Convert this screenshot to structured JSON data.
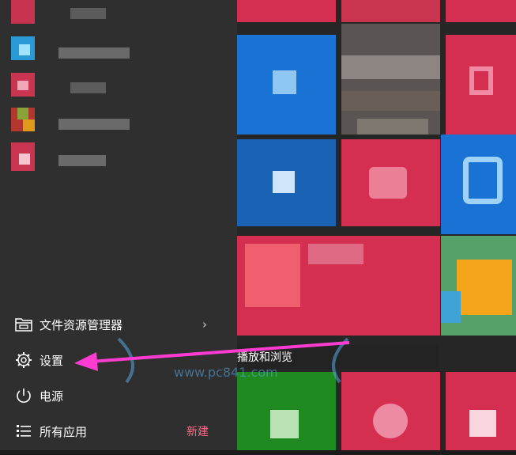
{
  "menu": {
    "file_explorer_label": "文件资源管理器",
    "settings_label": "设置",
    "power_label": "电源",
    "all_apps_label": "所有应用",
    "new_badge": "新建"
  },
  "tooltip": {
    "text": "播放和浏览"
  },
  "watermark": {
    "text": "www.pc841.com"
  },
  "colors": {
    "accent_red": "#d62b4e",
    "tile_blue": "#1a73d4",
    "tile_green": "#1f8a1f",
    "annotation_arrow": "#ff3bd2"
  },
  "icons": {
    "file_explorer": "folder-icon",
    "settings": "gear-icon",
    "power": "power-icon",
    "all_apps": "list-icon",
    "chevron": "chevron-right-icon"
  }
}
